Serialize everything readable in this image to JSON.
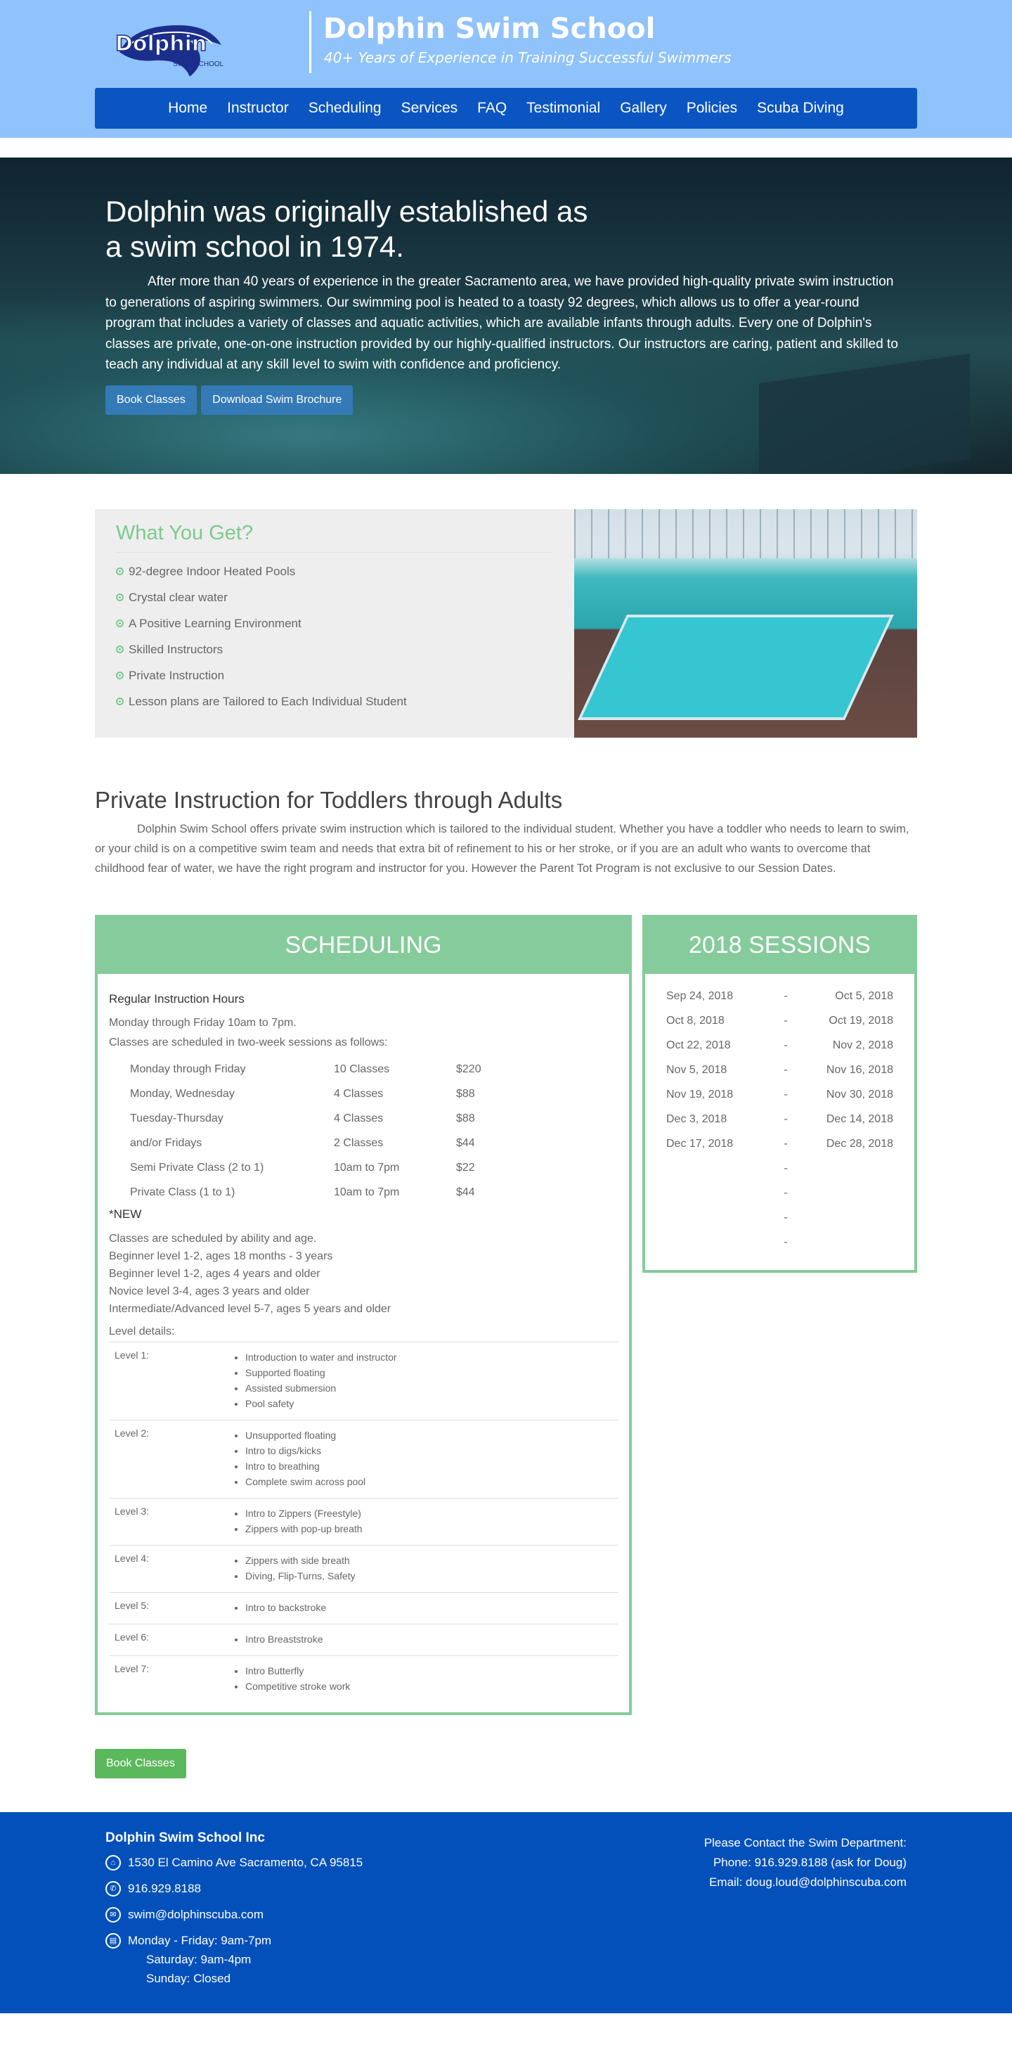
{
  "header": {
    "logo_text": "Dolphin",
    "logo_sub": "SWIM SCHOOL",
    "title": "Dolphin Swim School",
    "subtitle": "40+ Years of Experience in Training Successful Swimmers"
  },
  "nav": [
    "Home",
    "Instructor",
    "Scheduling",
    "Services",
    "FAQ",
    "Testimonial",
    "Gallery",
    "Policies",
    "Scuba Diving"
  ],
  "hero": {
    "heading_line1": "Dolphin was originally established as",
    "heading_line2": "a swim school in 1974.",
    "paragraph": "After more than 40 years of experience in the greater Sacramento area, we have provided high-quality private swim instruction to generations of aspiring swimmers. Our swimming pool is heated to a toasty 92 degrees, which allows us to offer a year-round program that includes a variety of classes and aquatic activities, which are available infants through adults. Every one of Dolphin's classes are private, one-on-one instruction provided by our highly-qualified instructors. Our instructors are caring, patient and skilled to teach any individual at any skill level to swim with confidence and proficiency.",
    "book_button": "Book Classes",
    "brochure_button": "Download Swim Brochure"
  },
  "what_you_get": {
    "title": "What You Get?",
    "items": [
      "92-degree Indoor Heated Pools",
      "Crystal clear water",
      "A Positive Learning Environment",
      "Skilled Instructors",
      "Private Instruction",
      "Lesson plans are Tailored to Each Individual Student"
    ]
  },
  "private": {
    "title": "Private Instruction for Toddlers through Adults",
    "text": "Dolphin Swim School offers private swim instruction which is tailored to the individual student. Whether you have a toddler who needs to learn to swim, or your child is on a competitive swim team and needs that extra bit of refinement to his or her stroke, or if you are an adult who wants to overcome that childhood fear of water, we have the right program and instructor for you. However the Parent Tot Program is not exclusive to our Session Dates."
  },
  "scheduling": {
    "title": "SCHEDULING",
    "hours_title": "Regular Instruction Hours",
    "hours": "Monday through Friday 10am to 7pm.",
    "sessions_note": "Classes are scheduled in two-week sessions as follows:",
    "prices": [
      [
        "Monday through Friday",
        "10 Classes",
        "$220"
      ],
      [
        "Monday, Wednesday",
        "4 Classes",
        "$88"
      ],
      [
        "Tuesday-Thursday",
        "4 Classes",
        "$88"
      ],
      [
        "and/or Fridays",
        "2 Classes",
        "$44"
      ],
      [
        "Semi Private Class (2 to 1)",
        "10am to 7pm",
        "$22"
      ],
      [
        "Private Class (1 to 1)",
        "10am to 7pm",
        "$44"
      ]
    ],
    "new_label": "*NEW",
    "ability": [
      "Classes are scheduled by ability and age.",
      "Beginner level 1-2, ages 18 months - 3 years",
      "Beginner level 1-2, ages 4 years and older",
      "Novice level 3-4, ages 3 years and older",
      "Intermediate/Advanced level 5-7, ages 5 years and older"
    ],
    "level_details_label": "Level details:",
    "levels": [
      {
        "name": "Level 1:",
        "items": [
          "Introduction to water and instructor",
          "Supported floating",
          "Assisted submersion",
          "Pool safety"
        ]
      },
      {
        "name": "Level 2:",
        "items": [
          "Unsupported floating",
          "Intro to digs/kicks",
          "Intro to breathing",
          "Complete swim across pool"
        ]
      },
      {
        "name": "Level 3:",
        "items": [
          "Intro to Zippers (Freestyle)",
          "Zippers with pop-up breath"
        ]
      },
      {
        "name": "Level 4:",
        "items": [
          "Zippers with side breath",
          "Diving, Flip-Turns, Safety"
        ]
      },
      {
        "name": "Level 5:",
        "items": [
          "Intro to backstroke"
        ]
      },
      {
        "name": "Level 6:",
        "items": [
          "Intro Breaststroke"
        ]
      },
      {
        "name": "Level 7:",
        "items": [
          "Intro Butterfly",
          "Competitive stroke work"
        ]
      }
    ]
  },
  "sessions": {
    "title": "2018 SESSIONS",
    "rows": [
      [
        "Sep 24, 2018",
        "-",
        "Oct 5, 2018"
      ],
      [
        "Oct 8, 2018",
        "-",
        "Oct 19, 2018"
      ],
      [
        "Oct 22, 2018",
        "-",
        "Nov 2, 2018"
      ],
      [
        "Nov 5, 2018",
        "-",
        "Nov 16, 2018"
      ],
      [
        "Nov 19, 2018",
        "-",
        "Nov 30, 2018"
      ],
      [
        "Dec 3, 2018",
        "-",
        "Dec 14, 2018"
      ],
      [
        "Dec 17, 2018",
        "-",
        "Dec 28, 2018"
      ],
      [
        "",
        "-",
        ""
      ],
      [
        "",
        "-",
        ""
      ],
      [
        "",
        "-",
        ""
      ],
      [
        "",
        "-",
        ""
      ]
    ]
  },
  "book_button": "Book Classes",
  "footer": {
    "company": "Dolphin Swim School Inc",
    "address": "1530 El Camino Ave Sacramento, CA 95815",
    "phone": "916.929.8188",
    "email": "swim@dolphinscuba.com",
    "hours": [
      "Monday - Friday: 9am-7pm",
      "Saturday: 9am-4pm",
      "Sunday: Closed"
    ],
    "contact_title": "Please Contact the Swim Department:",
    "contact_phone": "Phone: 916.929.8188 (ask for Doug)",
    "contact_email": "Email: doug.loud@dolphinscuba.com"
  },
  "colors": {
    "header_bg": "#90c3fb",
    "nav_bg": "#0b55c2",
    "accent_green": "#86cb9b",
    "footer_bg": "#0450bb"
  }
}
